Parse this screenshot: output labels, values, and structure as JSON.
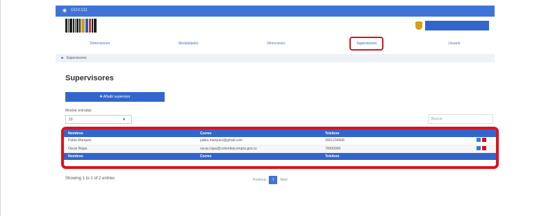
{
  "topbar": {
    "home_label": "GOV.CO"
  },
  "nav": {
    "items": [
      "Dimensiones",
      "Modalidades",
      "Direcciones",
      "Supervisores",
      "Usuario"
    ],
    "active_index": 3
  },
  "breadcrumb": {
    "label": "Supervisores"
  },
  "page": {
    "title": "Supervisores",
    "add_button": "Añadir supervisor"
  },
  "table_controls": {
    "show_label": "Mostrar entradas",
    "page_size": "10",
    "search_placeholder": "Buscar:"
  },
  "table": {
    "columns": [
      "Nombres",
      "Correo",
      "Telefono"
    ],
    "rows": [
      {
        "name": "Pablo Marquez",
        "email": "pablo.marquez@gmail.com",
        "phone": "3001234568"
      },
      {
        "name": "Oscar Rojas",
        "email": "oscar.rojas@colombiacompra.gov.co",
        "phone": "70000000"
      }
    ]
  },
  "footer": {
    "info": "Showing 1 to 2 of 2 entries",
    "prev": "Previous",
    "page": "1",
    "next": "Next"
  },
  "colors": {
    "primary": "#3366cc",
    "highlight": "#e0101a",
    "delete": "#d9101a"
  }
}
